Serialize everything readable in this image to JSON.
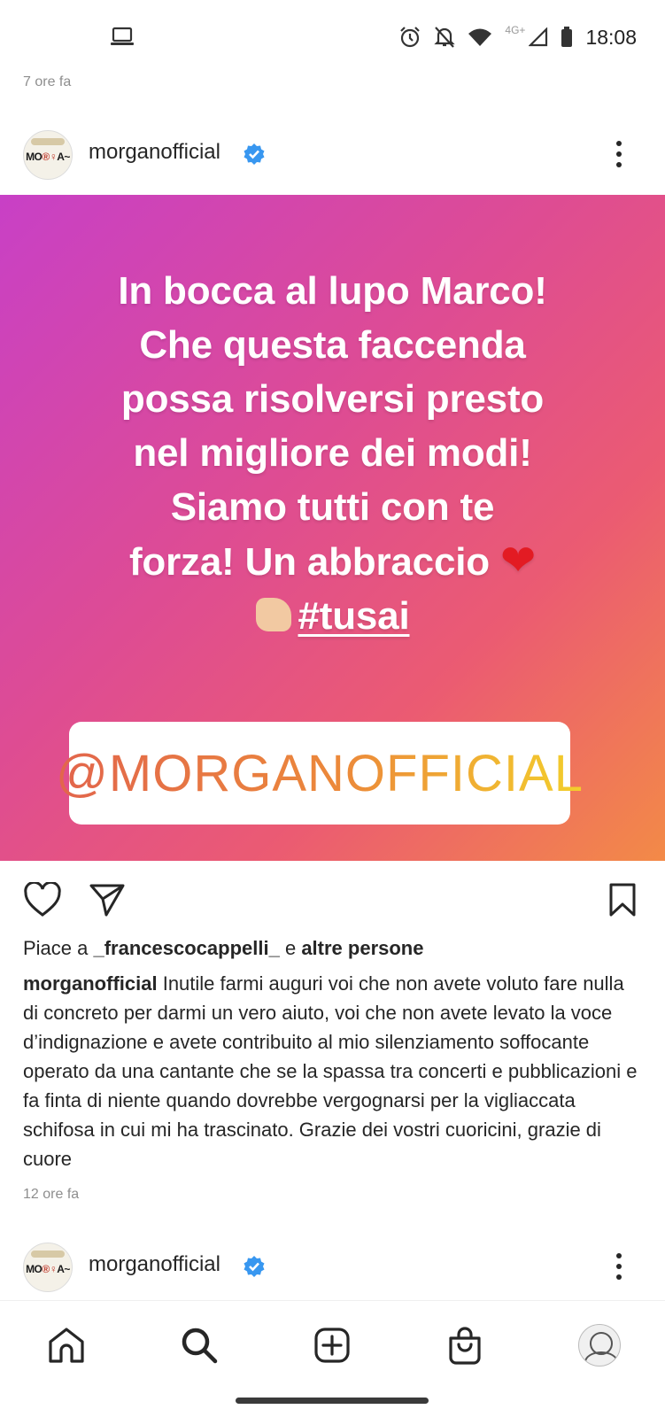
{
  "status_bar": {
    "time": "18:08",
    "network": "4G+"
  },
  "feed": {
    "top_time": "7 ore fa",
    "post": {
      "username": "morganofficial",
      "avatar_text": "MO",
      "avatar_text_2": "A~",
      "story_lines": [
        "In bocca al lupo Marco!",
        "Che questa faccenda",
        "possa risolversi presto",
        "nel migliore dei modi!",
        "Siamo tutti con te",
        "forza! Un abbraccio"
      ],
      "heart_emoji": "❤",
      "hashtag": "#tusai",
      "mention": "@MORGANOFFICIAL",
      "likes_prefix": "Piace a ",
      "likes_user": "_francescocappelli_",
      "likes_and": " e ",
      "likes_others": "altre persone",
      "caption_user": "morganofficial",
      "caption_text": "Inutile farmi auguri voi che non avete voluto fare nulla di concreto per darmi un vero aiuto, voi che non avete levato la voce d’indignazione e avete contribuito al mio silenziamento soffocante operato da una cantante che se la spassa tra concerti e pubblicazioni e fa finta di niente quando dovrebbe vergognarsi per la vigliaccata schifosa in cui mi ha trascinato. Grazie dei vostri cuoricini, grazie di cuore",
      "time": "12 ore fa"
    },
    "next_post": {
      "username": "morganofficial"
    }
  },
  "bottom_nav": [
    {
      "icon": "home-icon"
    },
    {
      "icon": "search-icon"
    },
    {
      "icon": "create-icon"
    },
    {
      "icon": "shop-icon"
    },
    {
      "icon": "profile-icon"
    }
  ],
  "colors": {
    "verified": "#3897f0",
    "gradient_start": "#c840c6",
    "gradient_end": "#f38a47"
  }
}
